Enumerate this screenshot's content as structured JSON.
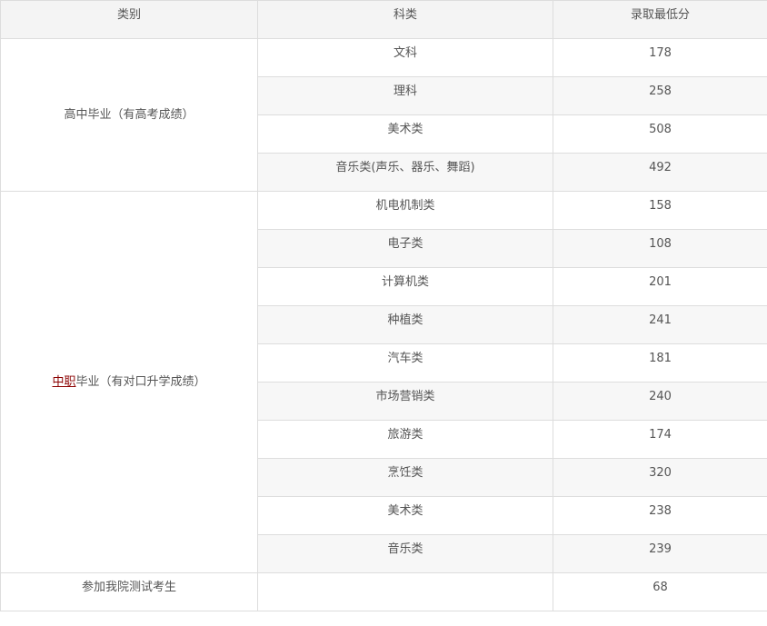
{
  "headers": {
    "category": "类别",
    "subject": "科类",
    "min_score": "录取最低分"
  },
  "groups": [
    {
      "category": "高中毕业（有高考成绩）",
      "rows": [
        {
          "subject": "文科",
          "score": "178"
        },
        {
          "subject": "理科",
          "score": "258"
        },
        {
          "subject": "美术类",
          "score": "508"
        },
        {
          "subject": "音乐类(声乐、器乐、舞蹈)",
          "score": "492"
        }
      ]
    },
    {
      "category_link": "中职",
      "category_rest": "毕业（有对口升学成绩）",
      "rows": [
        {
          "subject": "机电机制类",
          "score": "158"
        },
        {
          "subject": "电子类",
          "score": "108"
        },
        {
          "subject": "计算机类",
          "score": "201"
        },
        {
          "subject": "种植类",
          "score": "241"
        },
        {
          "subject": "汽车类",
          "score": "181"
        },
        {
          "subject": "市场营销类",
          "score": "240"
        },
        {
          "subject": "旅游类",
          "score": "174"
        },
        {
          "subject": "烹饪类",
          "score": "320"
        },
        {
          "subject": "美术类",
          "score": "238"
        },
        {
          "subject": "音乐类",
          "score": "239"
        }
      ]
    },
    {
      "category": "参加我院测试考生",
      "rows": [
        {
          "subject": "",
          "score": "68"
        }
      ]
    }
  ]
}
